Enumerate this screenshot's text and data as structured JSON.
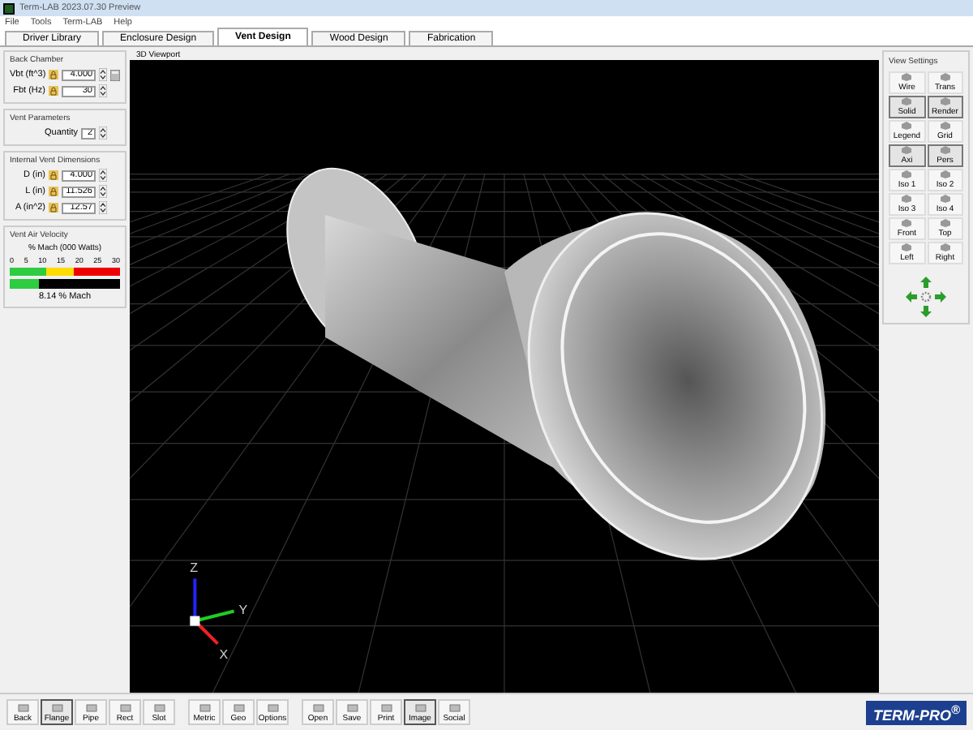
{
  "window": {
    "title": "Term-LAB 2023.07.30 Preview"
  },
  "menu": [
    "File",
    "Tools",
    "Term-LAB",
    "Help"
  ],
  "tabs": [
    {
      "label": "Driver Library",
      "selected": false
    },
    {
      "label": "Enclosure Design",
      "selected": false
    },
    {
      "label": "Vent Design",
      "selected": true
    },
    {
      "label": "Wood Design",
      "selected": false
    },
    {
      "label": "Fabrication",
      "selected": false
    }
  ],
  "left_panel": {
    "groups": [
      {
        "title": "Back Chamber",
        "fields": [
          {
            "label": "Vbt (ft^3)",
            "value": "4.000",
            "kind": "locked",
            "calc": true
          },
          {
            "label": "Fbt (Hz)",
            "value": "30",
            "kind": "locked",
            "calc": false
          }
        ]
      },
      {
        "title": "Vent Parameters",
        "fields": [
          {
            "label": "Quantity",
            "value": "2",
            "kind": "plain",
            "calc": false
          }
        ]
      },
      {
        "title": "Internal Vent Dimensions",
        "fields": [
          {
            "label": "D (in)",
            "value": "4.000",
            "kind": "locked",
            "calc": false
          },
          {
            "label": "L (in)",
            "value": "11.526",
            "kind": "locked",
            "calc": false
          },
          {
            "label": "A (in^2)",
            "value": "12.57",
            "kind": "locked",
            "calc": false
          }
        ]
      }
    ],
    "velocity": {
      "title": "Vent Air Velocity",
      "scale_title": "% Mach (000 Watts)",
      "ticks": [
        "0",
        "5",
        "10",
        "15",
        "20",
        "25",
        "30"
      ],
      "level": 0.27,
      "reading": "8.14 % Mach"
    }
  },
  "viewport": {
    "title": "3D Viewport",
    "axis_labels": [
      "Z",
      "Y",
      "X"
    ]
  },
  "view_settings": {
    "title": "View Settings",
    "buttons": [
      {
        "label": "Wire",
        "selected": false
      },
      {
        "label": "Trans",
        "selected": false
      },
      {
        "label": "Solid",
        "selected": true
      },
      {
        "label": "Render",
        "selected": true
      },
      {
        "label": "Legend",
        "selected": false
      },
      {
        "label": "Grid",
        "selected": false
      },
      {
        "label": "Axi",
        "selected": true
      },
      {
        "label": "Pers",
        "selected": true
      },
      {
        "label": "Iso 1",
        "selected": false
      },
      {
        "label": "Iso 2",
        "selected": false
      },
      {
        "label": "Iso 3",
        "selected": false
      },
      {
        "label": "Iso 4",
        "selected": false
      },
      {
        "label": "Front",
        "selected": false
      },
      {
        "label": "Top",
        "selected": false
      },
      {
        "label": "Left",
        "selected": false
      },
      {
        "label": "Right",
        "selected": false
      }
    ]
  },
  "toolbar": {
    "groups": [
      [
        {
          "label": "Back",
          "selected": false
        },
        {
          "label": "Flange",
          "selected": true
        },
        {
          "label": "Pipe",
          "selected": false
        },
        {
          "label": "Rect",
          "selected": false
        },
        {
          "label": "Slot",
          "selected": false
        }
      ],
      [
        {
          "label": "Metric",
          "selected": false
        },
        {
          "label": "Geo",
          "selected": false
        },
        {
          "label": "Options",
          "selected": false
        }
      ],
      [
        {
          "label": "Open",
          "selected": false
        },
        {
          "label": "Save",
          "selected": false
        },
        {
          "label": "Print",
          "selected": false
        },
        {
          "label": "Image",
          "selected": true
        },
        {
          "label": "Social",
          "selected": false
        }
      ]
    ]
  },
  "logo": "TERM-PRO$^{®}$"
}
